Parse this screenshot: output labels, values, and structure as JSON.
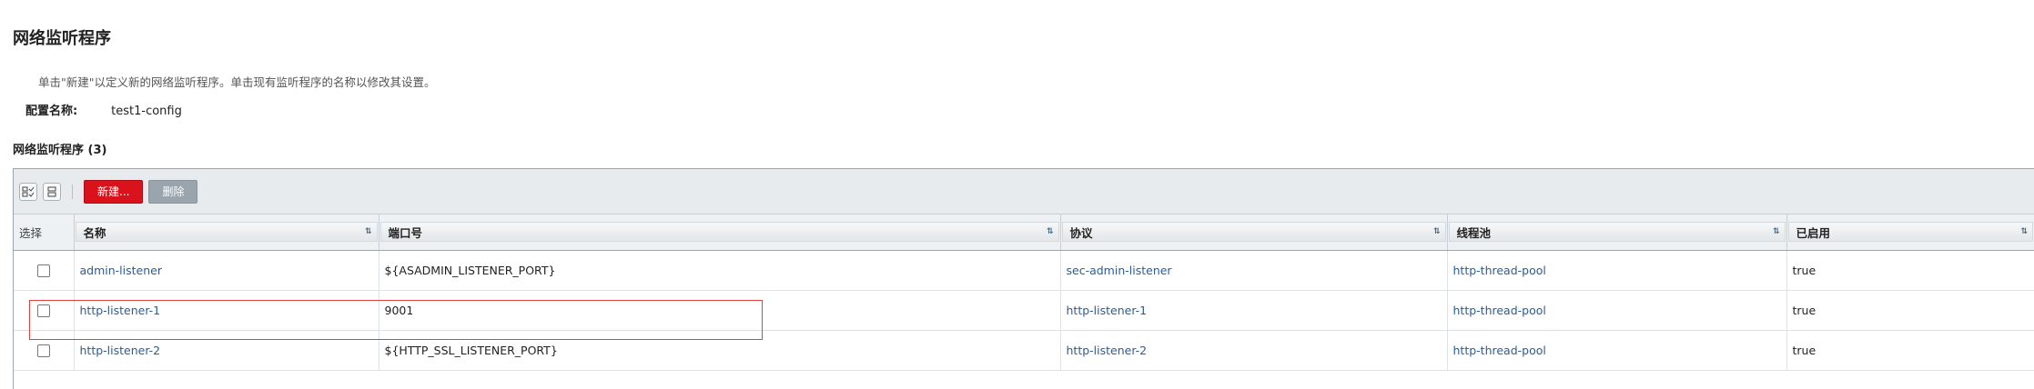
{
  "page": {
    "title": "网络监听程序",
    "help_text": "单击\"新建\"以定义新的网络监听程序。单击现有监听程序的名称以修改其设置。",
    "config_label": "配置名称:",
    "config_value": "test1-config"
  },
  "table": {
    "title": "网络监听程序 (3)",
    "toolbar": {
      "new_label": "新建...",
      "delete_label": "删除"
    },
    "columns": [
      "选择",
      "名称",
      "端口号",
      "协议",
      "线程池",
      "已启用"
    ],
    "sort_glyph": "⇅",
    "rows": [
      {
        "name": "admin-listener",
        "port": "${ASADMIN_LISTENER_PORT}",
        "protocol": "sec-admin-listener",
        "thread_pool": "http-thread-pool",
        "enabled": "true"
      },
      {
        "name": "http-listener-1",
        "port": "9001",
        "protocol": "http-listener-1",
        "thread_pool": "http-thread-pool",
        "enabled": "true"
      },
      {
        "name": "http-listener-2",
        "port": "${HTTP_SSL_LISTENER_PORT}",
        "protocol": "http-listener-2",
        "thread_pool": "http-thread-pool",
        "enabled": "true"
      }
    ]
  },
  "icons": {
    "select_all": "select-all-icon",
    "deselect_all": "deselect-all-icon",
    "sort": "sort-icon"
  },
  "colors": {
    "new_button": "#d9121b",
    "delete_button": "#9aa4ad",
    "link": "#2a5c96",
    "highlight": "#e0413a"
  }
}
